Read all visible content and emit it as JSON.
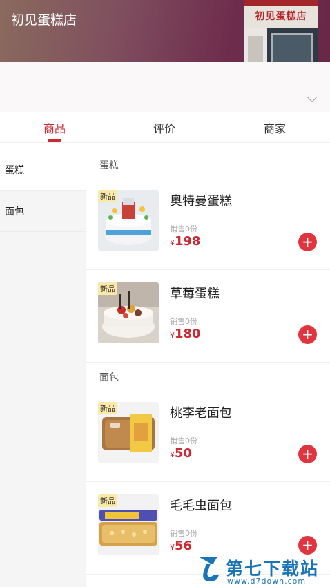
{
  "store": {
    "title": "初见蛋糕店",
    "sign_text": "初见蛋糕店"
  },
  "tabs": [
    {
      "label": "商品",
      "active": true
    },
    {
      "label": "评价",
      "active": false
    },
    {
      "label": "商家",
      "active": false
    }
  ],
  "sidebar": {
    "items": [
      {
        "label": "蛋糕",
        "active": true
      },
      {
        "label": "面包",
        "active": false
      }
    ]
  },
  "sections": [
    {
      "title": "蛋糕",
      "products": [
        {
          "badge": "新品",
          "name": "奥特曼蛋糕",
          "sold": "销售0份",
          "currency": "¥",
          "price": "198"
        },
        {
          "badge": "新品",
          "name": "草莓蛋糕",
          "sold": "销售0份",
          "currency": "¥",
          "price": "180"
        }
      ]
    },
    {
      "title": "面包",
      "products": [
        {
          "badge": "新品",
          "name": "桃李老面包",
          "sold": "销售0份",
          "currency": "¥",
          "price": "50"
        },
        {
          "badge": "新品",
          "name": "毛毛虫面包",
          "sold": "销售0份",
          "currency": "¥",
          "price": "56"
        }
      ]
    }
  ],
  "add_button_icon": "plus-icon",
  "colors": {
    "accent": "#c92a33",
    "add_button": "#e0353f",
    "badge_bg": "#fbe9a8"
  },
  "watermark": {
    "text": "第七下载站",
    "url": "www.d7down.com"
  }
}
